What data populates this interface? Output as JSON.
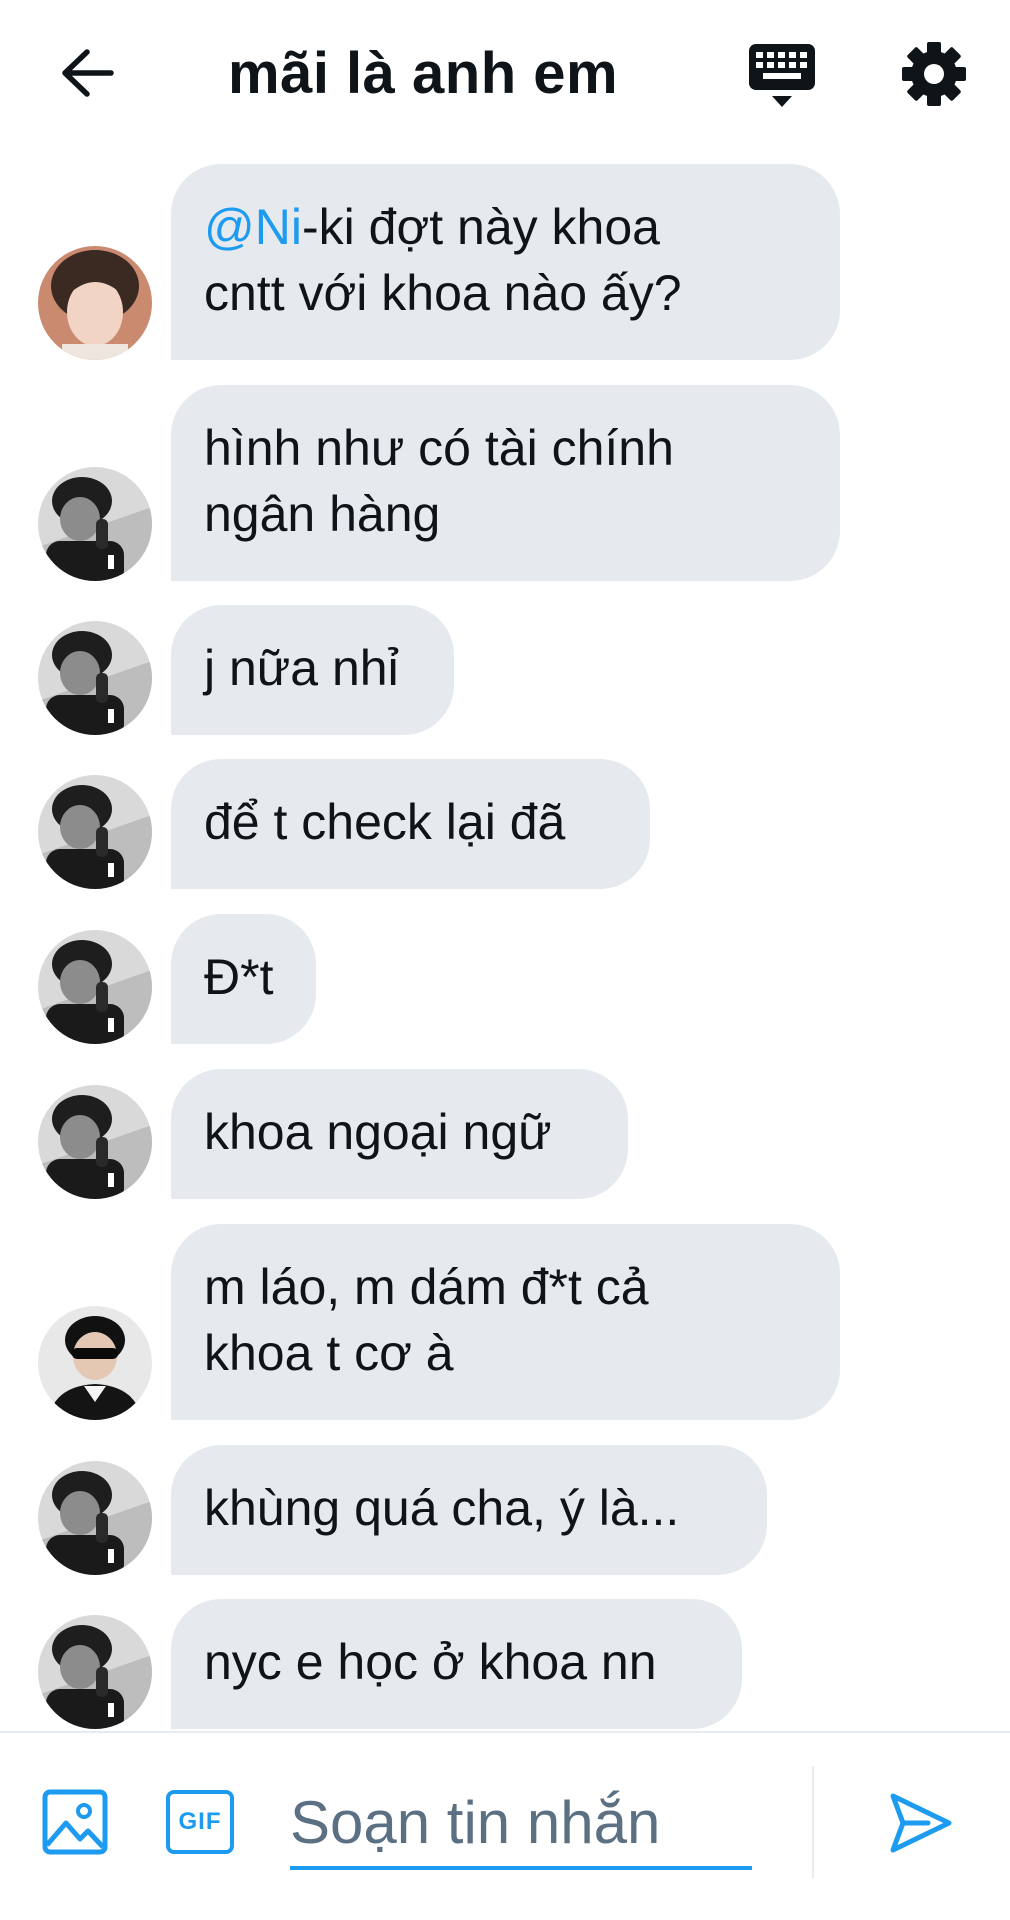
{
  "header": {
    "title": "mãi là anh em",
    "back_icon": "arrow-left-icon",
    "keyboard_icon": "keyboard-icon",
    "settings_icon": "gear-icon"
  },
  "messages": [
    {
      "mention": "@Ni",
      "text": "-ki đợt này khoa\ncntt với khoa nào ấy?",
      "avatar": "avatar-user-1"
    },
    {
      "mention": "",
      "text": "hình như có tài chính\nngân hàng",
      "avatar": "avatar-user-2"
    },
    {
      "mention": "",
      "text": "j nữa nhỉ",
      "avatar": "avatar-user-2"
    },
    {
      "mention": "",
      "text": "để t check lại đã",
      "avatar": "avatar-user-2"
    },
    {
      "mention": "",
      "text": "Đ*t",
      "avatar": "avatar-user-2"
    },
    {
      "mention": "",
      "text": "khoa ngoại ngữ",
      "avatar": "avatar-user-2"
    },
    {
      "mention": "",
      "text": "m láo, m dám đ*t cả\nkhoa t cơ à",
      "avatar": "avatar-user-3"
    },
    {
      "mention": "",
      "text": "khùng quá cha, ý là...",
      "avatar": "avatar-user-2"
    },
    {
      "mention": "",
      "text": "nyc e học ở khoa nn",
      "avatar": "avatar-user-2"
    }
  ],
  "composer": {
    "placeholder": "Soạn tin nhắn",
    "value": "",
    "media_icon": "image-icon",
    "gif_label": "GIF",
    "send_icon": "send-icon"
  },
  "colors": {
    "accent": "#1d9bf0",
    "bubble": "#e6eaee",
    "text": "#0f1419",
    "placeholder": "#5b7083"
  }
}
